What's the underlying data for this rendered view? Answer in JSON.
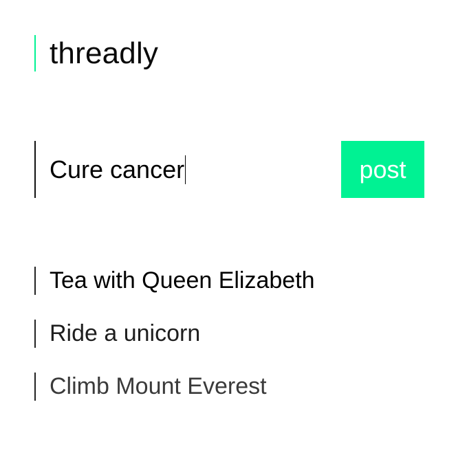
{
  "app": {
    "title": "threadly",
    "accent_color": "#00f293"
  },
  "composer": {
    "value": "Cure cancer",
    "post_label": "post"
  },
  "threads": [
    {
      "label": "Tea with Queen Elizabeth"
    },
    {
      "label": "Ride a unicorn"
    },
    {
      "label": "Climb Mount Everest"
    }
  ]
}
